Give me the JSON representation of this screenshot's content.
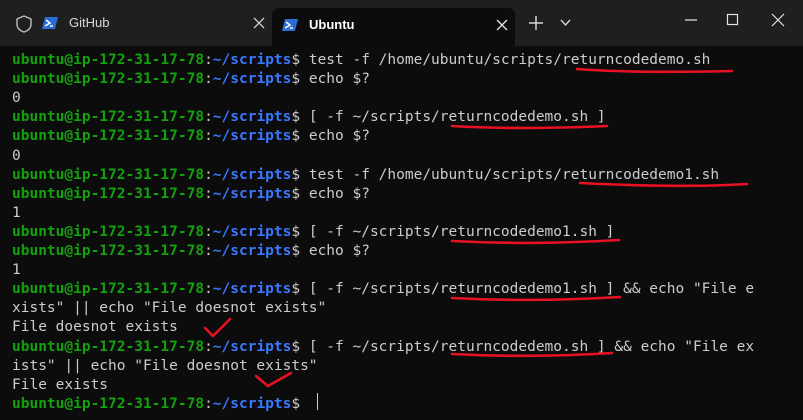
{
  "tabs": [
    {
      "title": "GitHub",
      "active": false
    },
    {
      "title": "Ubuntu",
      "active": true
    }
  ],
  "colors": {
    "prompt_user": "#13a10e",
    "prompt_path": "#3b78ff",
    "text": "#cccccc",
    "background": "#0c0c0c",
    "annotation": "#e81123"
  },
  "prompt": {
    "user": "ubuntu@ip-172-31-17-78",
    "path": "~/scripts",
    "symbol": "$"
  },
  "lines": [
    {
      "kind": "prompt",
      "cmd": "test -f /home/ubuntu/scripts/returncodedemo.sh"
    },
    {
      "kind": "prompt",
      "cmd": "echo $?"
    },
    {
      "kind": "output",
      "text": "0"
    },
    {
      "kind": "prompt",
      "cmd": "[ -f ~/scripts/returncodedemo.sh ]"
    },
    {
      "kind": "prompt",
      "cmd": "echo $?"
    },
    {
      "kind": "output",
      "text": "0"
    },
    {
      "kind": "prompt",
      "cmd": "test -f /home/ubuntu/scripts/returncodedemo1.sh"
    },
    {
      "kind": "prompt",
      "cmd": "echo $?"
    },
    {
      "kind": "output",
      "text": "1"
    },
    {
      "kind": "prompt",
      "cmd": "[ -f ~/scripts/returncodedemo1.sh ]"
    },
    {
      "kind": "prompt",
      "cmd": "echo $?"
    },
    {
      "kind": "output",
      "text": "1"
    },
    {
      "kind": "prompt",
      "cmd": "[ -f ~/scripts/returncodedemo1.sh ] && echo \"File e"
    },
    {
      "kind": "output",
      "text": "xists\" || echo \"File doesnot exists\""
    },
    {
      "kind": "output",
      "text": "File doesnot exists"
    },
    {
      "kind": "prompt",
      "cmd": "[ -f ~/scripts/returncodedemo.sh ] && echo \"File ex"
    },
    {
      "kind": "output",
      "text": "ists\" || echo \"File doesnot exists\""
    },
    {
      "kind": "output",
      "text": "File exists"
    },
    {
      "kind": "prompt",
      "cmd": ""
    }
  ]
}
